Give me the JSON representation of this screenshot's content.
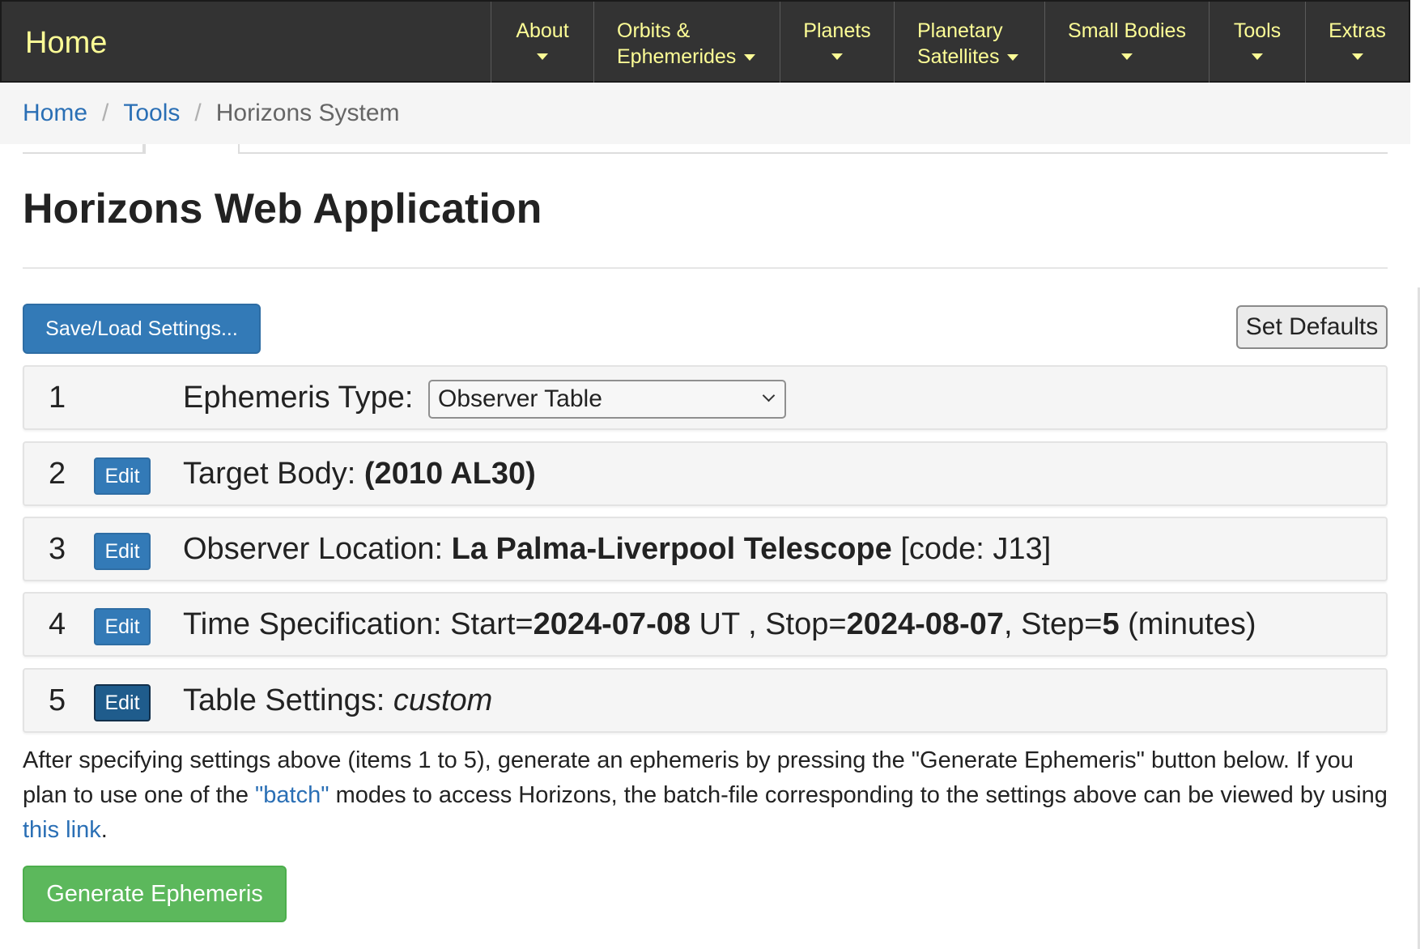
{
  "nav": {
    "brand": "Home",
    "items": [
      {
        "line1": "About",
        "line2": ""
      },
      {
        "line1": "Orbits &",
        "line2": "Ephemerides"
      },
      {
        "line1": "Planets",
        "line2": ""
      },
      {
        "line1": "Planetary",
        "line2": "Satellites"
      },
      {
        "line1": "Small Bodies",
        "line2": ""
      },
      {
        "line1": "Tools",
        "line2": ""
      },
      {
        "line1": "Extras",
        "line2": ""
      }
    ]
  },
  "breadcrumb": {
    "home": "Home",
    "tools": "Tools",
    "current": "Horizons System",
    "separator": "/"
  },
  "page": {
    "title": "Horizons Web Application"
  },
  "buttons": {
    "save_load": "Save/Load Settings...",
    "set_defaults": "Set Defaults",
    "edit": "Edit",
    "generate": "Generate Ephemeris"
  },
  "steps": {
    "s1": {
      "num": "1",
      "label": "Ephemeris Type:",
      "select_value": "Observer Table"
    },
    "s2": {
      "num": "2",
      "label": "Target Body:",
      "value": "(2010 AL30)"
    },
    "s3": {
      "num": "3",
      "label": "Observer Location:",
      "value": "La Palma-Liverpool Telescope",
      "suffix": "[code: J13]"
    },
    "s4": {
      "num": "4",
      "label": "Time Specification: Start=",
      "start": "2024-07-08",
      "mid": " UT , Stop=",
      "stop": "2024-08-07",
      "mid2": ", Step=",
      "step": "5",
      "unit": " (minutes)"
    },
    "s5": {
      "num": "5",
      "label": "Table Settings:",
      "value": "custom"
    }
  },
  "info": {
    "text1": "After specifying settings above (items 1 to 5), generate an ephemeris by pressing the \"Generate Ephemeris\" button below. If you plan to use one of the ",
    "batch_link": "\"batch\"",
    "text2": " modes to access Horizons, the batch-file corresponding to the settings above can be viewed by using ",
    "this_link": "this link",
    "text3": "."
  },
  "colors": {
    "navbar_bg": "#333333",
    "nav_text": "#fdfd96",
    "link": "#2a6fb5",
    "primary": "#337ab7",
    "success": "#5cb85c"
  }
}
